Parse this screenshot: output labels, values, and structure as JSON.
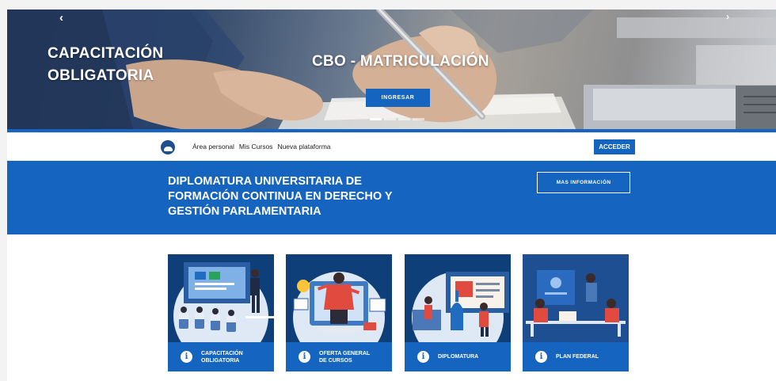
{
  "hero": {
    "left_title_line1": "CAPACITACIÓN",
    "left_title_line2": "OBLIGATORIA",
    "center_title": "CBO - MATRICULACIÓN",
    "button_label": "INGRESAR",
    "prev_icon": "‹",
    "next_icon": "›",
    "active_slide": 1,
    "slide_count": 4
  },
  "nav": {
    "links": [
      "Área personal",
      "Mis Cursos",
      "Nueva plataforma"
    ],
    "login_button": "ACCEDER"
  },
  "band": {
    "title": "DIPLOMATURA UNIVERSITARIA DE FORMACIÓN CONTINUA EN DERECHO Y GESTIÓN PARLAMENTARIA",
    "button_label": "MAS INFORMACIÓN"
  },
  "cards": [
    {
      "line1": "CAPACITACIÓN",
      "line2": "OBLIGATORIA"
    },
    {
      "line1": "OFERTA GENERAL",
      "line2": "DE CURSOS"
    },
    {
      "line1": "DIPLOMATURA",
      "line2": ""
    },
    {
      "line1": "PLAN FEDERAL",
      "line2": ""
    }
  ],
  "info_glyph": "i",
  "colors": {
    "primary_blue": "#1565c0",
    "card_navy": "#0f3f79",
    "text_white": "#ffffff"
  }
}
